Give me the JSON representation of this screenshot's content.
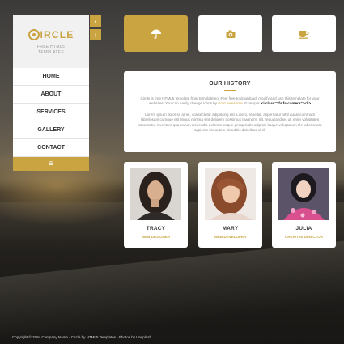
{
  "brand": {
    "logo_letter": "C",
    "logo_rest": "IRCLE",
    "tagline": "FREE HTML5 TEMPLATES",
    "accent_color": "#c9a441"
  },
  "nav_arrows": [
    {
      "icon": "chevron-left-icon",
      "glyph": "‹"
    },
    {
      "icon": "chevron-right-icon",
      "glyph": "›"
    }
  ],
  "menu": {
    "items": [
      "HOME",
      "ABOUT",
      "SERVICES",
      "GALLERY",
      "CONTACT"
    ],
    "toggle_glyph": "≡",
    "toggle_icon": "hamburger-icon"
  },
  "top_buttons": [
    {
      "icon": "umbrella-icon",
      "active": true
    },
    {
      "icon": "camera-icon",
      "active": false
    },
    {
      "icon": "coffee-cup-icon",
      "active": false
    }
  ],
  "history": {
    "title": "OUR HISTORY",
    "p1_a": "Circle is free HTML5 template from templatemo. Feel free to download, modify and use this template for your websites. You can easily change icons by ",
    "p1_link": "Font Awesome",
    "p1_b": ". Example: ",
    "p1_code": "<i class=\"fa fa-camera\"></i>",
    "p2": "Lorem ipsum dolor sit amet, consectetur adipiscing elit. Libero, repellat, aspernatur nihil quasi commodi laboriosam cumque est minus minima sint dolorem possimus magnam. Sit, repudiandae, ut, enim voluptates aspernatur inventore qua earum reiciendis dolorum eaque perspiciatis adipisci itaque voluptatum tile laboriosam sapiente hic autem blanditiis doloribus nihil."
  },
  "team": [
    {
      "name": "TRACY",
      "role": "WEB DESIGNER"
    },
    {
      "name": "MARY",
      "role": "WEB DEVELOPER"
    },
    {
      "name": "JULIA",
      "role": "CREATIVE DIRECTOR"
    }
  ],
  "footer": "Copyright © 2084 Company Name - Circle by HTML5 Templates - Photos by Unsplash"
}
